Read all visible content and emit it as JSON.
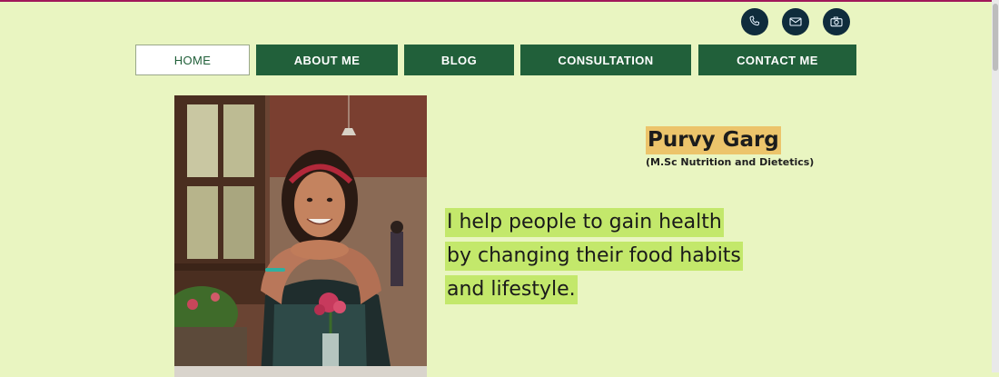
{
  "social": [
    {
      "name": "phone-icon"
    },
    {
      "name": "mail-icon"
    },
    {
      "name": "camera-icon"
    }
  ],
  "nav": {
    "items": [
      {
        "label": "HOME",
        "active": true
      },
      {
        "label": "ABOUT ME",
        "active": false
      },
      {
        "label": "BLOG",
        "active": false
      },
      {
        "label": "CONSULTATION",
        "active": false
      },
      {
        "label": "CONTACT ME",
        "active": false
      }
    ]
  },
  "profile": {
    "name": "Purvy Garg",
    "degree": "(M.Sc Nutrition and Dietetics)"
  },
  "tagline": {
    "lines": [
      "I help people to gain health",
      "by changing their food habits",
      "and lifestyle."
    ]
  },
  "colors": {
    "background": "#e9f5c1",
    "nav_green": "#21603a",
    "name_highlight": "#ecc46b",
    "tagline_highlight": "#c3e86b",
    "icon_circle": "#0f2c3c"
  }
}
